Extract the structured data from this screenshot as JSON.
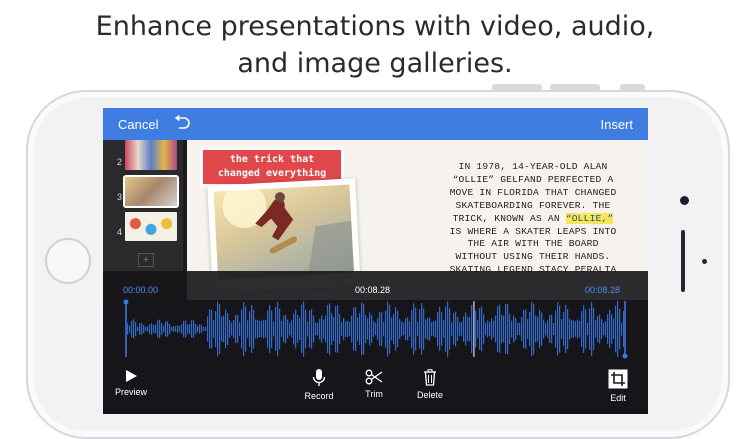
{
  "headline": {
    "line1": "Enhance presentations with video, audio,",
    "line2": "and image galleries."
  },
  "navbar": {
    "cancel_label": "Cancel",
    "undo_icon": "undo-arrow-icon",
    "insert_label": "Insert",
    "bg_color": "#3f7de0"
  },
  "slide_thumbnails": [
    {
      "number": "2"
    },
    {
      "number": "3"
    },
    {
      "number": "4"
    }
  ],
  "slide": {
    "callout_line1": "the trick that",
    "callout_line2": "changed everything",
    "story_lines": [
      "IN 1978, 14-YEAR-OLD ALAN",
      "“OLLIE” GELFAND PERFECTED A",
      "MOVE IN FLORIDA THAT CHANGED",
      "SKATEBOARDING FOREVER. THE",
      "TRICK, KNOWN AS AN ",
      "IS WHERE A SKATER LEAPS INTO",
      "THE AIR WITH THE BOARD",
      "WITHOUT USING THEIR HANDS.",
      "SKATING LEGEND STACY PERALTA"
    ],
    "highlight": "“OLLIE,”"
  },
  "audio_editor": {
    "time_start": "00:00.00",
    "time_current": "00:08.28",
    "time_end": "00:08.28",
    "accent_color": "#3a78e8"
  },
  "toolbar": {
    "preview_label": "Preview",
    "record_label": "Record",
    "trim_label": "Trim",
    "delete_label": "Delete",
    "edit_label": "Edit"
  }
}
